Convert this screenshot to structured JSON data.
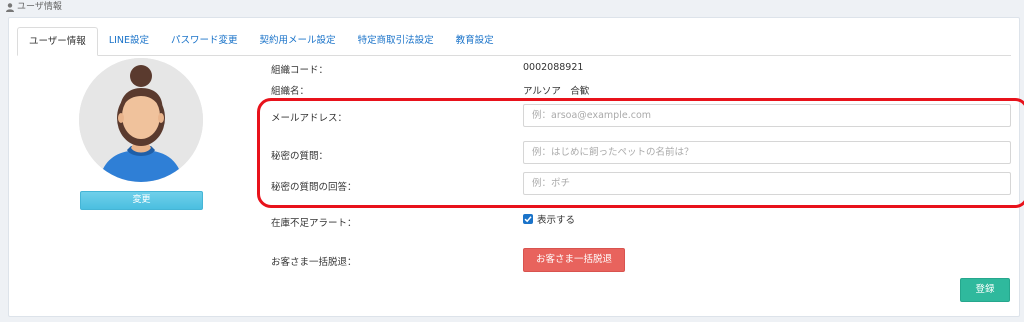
{
  "page_header": {
    "title": "ユーザ情報",
    "icon": "user-icon"
  },
  "tabs": [
    {
      "label": "ユーザー情報",
      "active": true
    },
    {
      "label": "LINE設定"
    },
    {
      "label": "パスワード変更"
    },
    {
      "label": "契約用メール設定"
    },
    {
      "label": "特定商取引法設定"
    },
    {
      "label": "教育設定"
    }
  ],
  "avatar": {
    "change_label": "変更"
  },
  "org": {
    "code_label": "組織コード：",
    "code_value": "0002088921",
    "name_label": "組織名：",
    "name_value": "アルソア　合歓"
  },
  "form": {
    "email_label": "メールアドレス：",
    "email_placeholder": "例：arsoa@example.com",
    "question_label": "秘密の質問：",
    "question_placeholder": "例：はじめに飼ったペットの名前は？",
    "answer_label": "秘密の質問の回答：",
    "answer_placeholder": "例：ポチ"
  },
  "stock_alert": {
    "label": "在庫不足アラート：",
    "checkbox_label": "表示する",
    "checked": true
  },
  "bulk_withdraw": {
    "label": "お客さま一括脱退：",
    "button_label": "お客さま一括脱退"
  },
  "register_label": "登録",
  "colors": {
    "accent": "#1a73c9",
    "danger": "#e8635d",
    "success": "#2fb99d",
    "info": "#4bbfe0",
    "highlight": "#e8121b"
  }
}
